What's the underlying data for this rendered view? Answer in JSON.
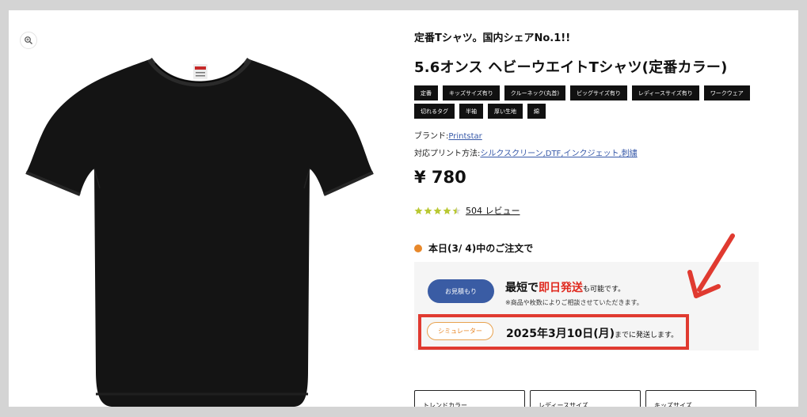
{
  "product": {
    "subtitle": "定番Tシャツ。国内シェアNo.1!!",
    "title": "5.6オンス ヘビーウエイトTシャツ(定番カラー)",
    "tags": [
      "定番",
      "キッズサイズ有り",
      "クルーネック(丸首)",
      "ビッグサイズ有り",
      "レディースサイズ有り",
      "ワークウェア",
      "切れるタグ",
      "半袖",
      "厚い生地",
      "綿"
    ],
    "brand_label": "ブランド:",
    "brand_value": "Printstar",
    "print_label": "対応プリント方法:",
    "print_value": "シルクスクリーン,DTF,インクジェット,刺繍",
    "price": "¥ 780",
    "rating_value": 4.5,
    "review_count": "504 レビュー"
  },
  "shipping": {
    "today_text": "本日(3/ 4)中のご注文で",
    "estimate_button": "お見積もり",
    "fast_prefix": "最短で",
    "fast_highlight": "即日発送",
    "fast_suffix": "も可能です。",
    "note": "※商品や枚数によりご相談させていただきます。",
    "simulator_button": "シミュレーター",
    "ship_date": "2025年3月10日(月)",
    "ship_suffix": "までに発送します。"
  },
  "selectors": [
    "トレンドカラー",
    "レディースサイズ",
    "キッズサイズ"
  ],
  "colors": {
    "shirt": "#141414",
    "accent_blue": "#3a5ca4",
    "accent_orange": "#e8882a",
    "highlight_red": "#e02b20",
    "annotation_red": "#e03a30",
    "star": "#b9c832"
  },
  "icons": {
    "zoom": "zoom-in-icon",
    "annotation": "red-arrow-annotation"
  }
}
